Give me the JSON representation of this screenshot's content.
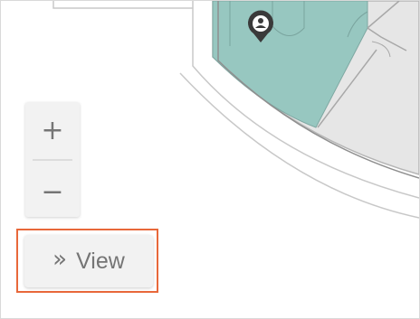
{
  "map": {
    "region_color": "#97c7c0",
    "floor_color": "#e6e6e6",
    "marker_icon": "person-pin-icon"
  },
  "zoom": {
    "zoom_in_label": "+",
    "zoom_out_label": "−"
  },
  "view_button": {
    "icon_label": "»",
    "label": "View",
    "highlight_color": "#e8683a"
  }
}
